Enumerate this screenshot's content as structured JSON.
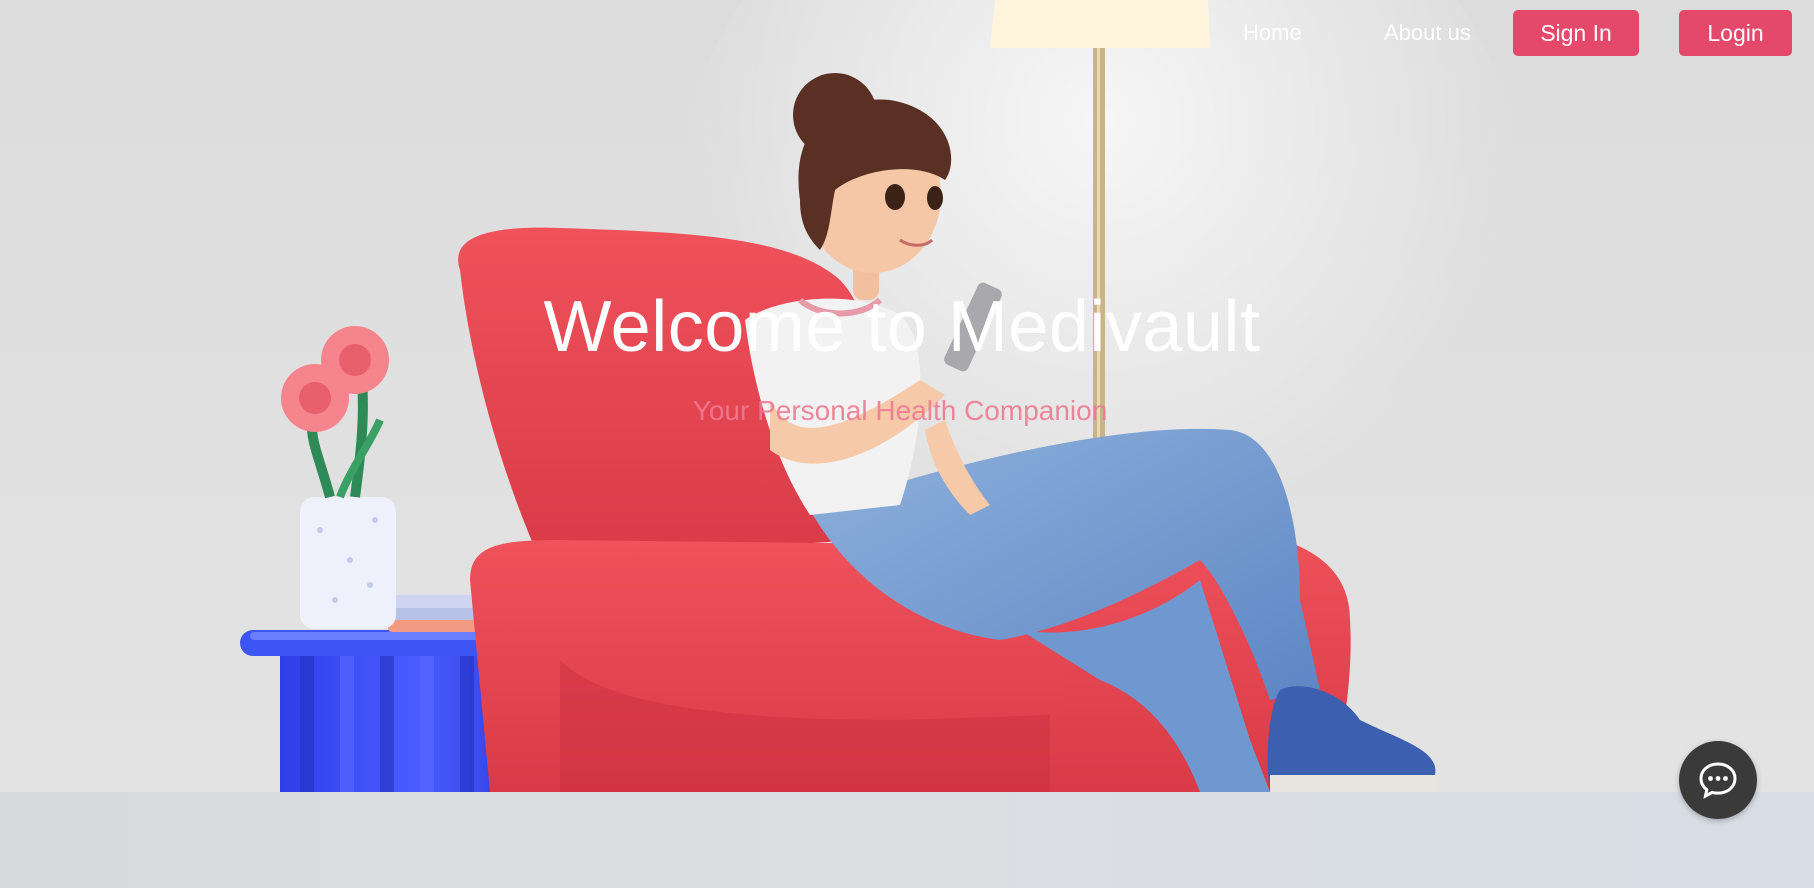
{
  "nav": {
    "home": "Home",
    "about": "About us",
    "sign_in": "Sign In",
    "login": "Login"
  },
  "hero": {
    "title": "Welcome to Medivault",
    "subtitle": "Your Personal Health Companion"
  },
  "chat": {
    "icon": "chat-bubble-icon"
  },
  "colors": {
    "accent": "#e4486a",
    "chair": "#e7454f",
    "table": "#3a4df0",
    "background": "#dcdcdc"
  }
}
